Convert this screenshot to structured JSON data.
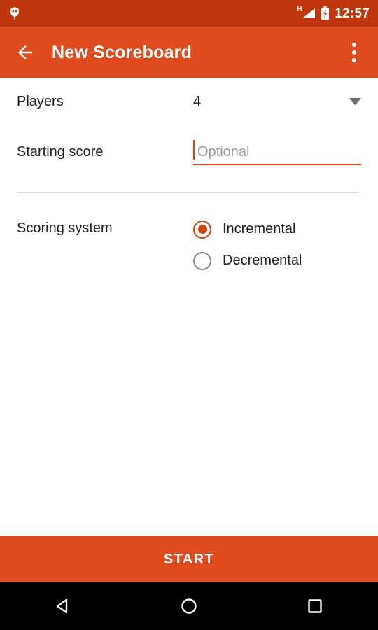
{
  "status_bar": {
    "notification_icon": "app-notification-icon",
    "network_type": "H",
    "signal_icon": "signal-bars-icon",
    "battery_icon": "battery-charging-icon",
    "time": "12:57",
    "background_color": "#BF360C"
  },
  "app_bar": {
    "back_icon": "back-arrow-icon",
    "title": "New Scoreboard",
    "overflow_icon": "more-vertical-icon",
    "background_color": "#DD4B1E",
    "text_color": "#FFFFFF"
  },
  "form": {
    "players": {
      "label": "Players",
      "value": "4",
      "dropdown_icon": "chevron-down-icon"
    },
    "starting_score": {
      "label": "Starting score",
      "value": "",
      "placeholder": "Optional",
      "underline_color": "#D84315",
      "focused": true
    },
    "scoring_system": {
      "label": "Scoring system",
      "options": [
        {
          "label": "Incremental",
          "selected": true
        },
        {
          "label": "Decremental",
          "selected": false
        }
      ],
      "accent_color": "#D84315"
    }
  },
  "footer": {
    "start_label": "START",
    "background_color": "#DD4B1E"
  },
  "nav_bar": {
    "back_icon": "nav-back-triangle-icon",
    "home_icon": "nav-home-circle-icon",
    "recents_icon": "nav-recents-square-icon",
    "background_color": "#000000"
  }
}
